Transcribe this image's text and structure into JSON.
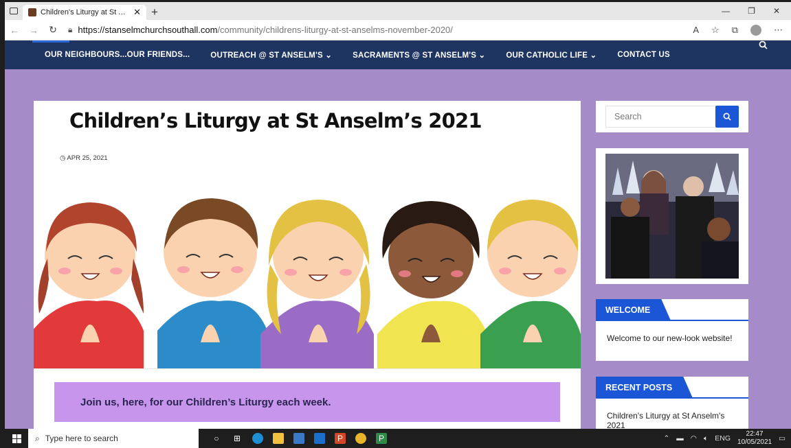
{
  "browser": {
    "tab_title": "Children's Liturgy at St Anselm's",
    "tab_close": "✕",
    "new_tab": "+",
    "url_host": "https://stanselmchurchsouthall.com",
    "url_path": "/community/childrens-liturgy-at-st-anselms-november-2020/"
  },
  "nav": {
    "items": [
      "OUR NEIGHBOURS...OUR FRIENDS...",
      "OUTREACH @ ST ANSELM'S ⌄",
      "SACRAMENTS @ ST ANSELM'S ⌄",
      "OUR CATHOLIC LIFE ⌄",
      "CONTACT US"
    ]
  },
  "post": {
    "title": "Children’s Liturgy at St Anselm’s 2021",
    "date": "APR 25, 2021",
    "banner": "Join us, here, for our Children’s Liturgy each week."
  },
  "sidebar": {
    "search_placeholder": "Search",
    "welcome": {
      "heading": "WELCOME",
      "text": "Welcome to our new-look website!"
    },
    "recent": {
      "heading": "RECENT POSTS",
      "first_post": "Children's Liturgy at St Anselm's 2021"
    }
  },
  "taskbar": {
    "search_placeholder": "Type here to search",
    "lang": "ENG",
    "time": "22:47",
    "date": "10/05/2021"
  },
  "colors": {
    "nav_bg": "#1e3461",
    "page_bg": "#a58bc8",
    "accent": "#1a56d6",
    "banner_bg": "#c796ec"
  }
}
